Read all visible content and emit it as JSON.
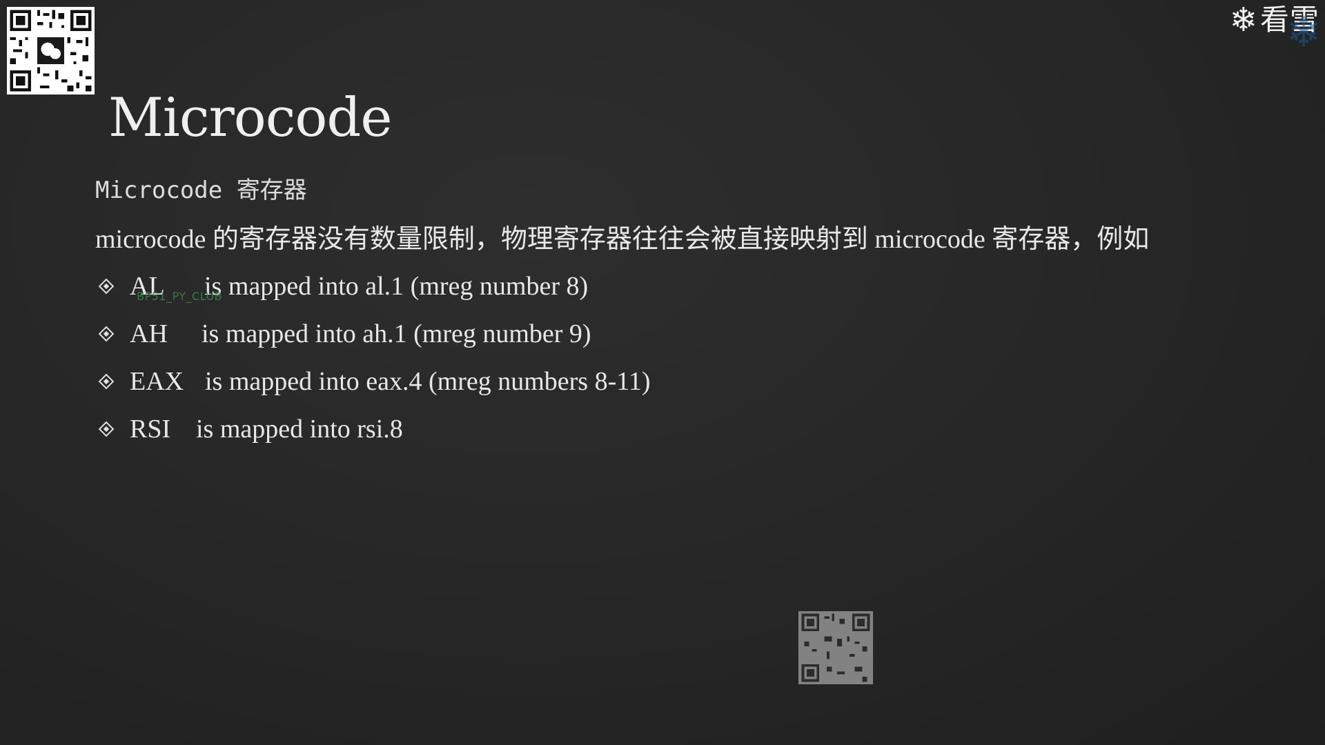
{
  "slide": {
    "title": "Microcode",
    "subtitle": "Microcode 寄存器",
    "intro": "microcode 的寄存器没有数量限制，物理寄存器往往会被直接映射到 microcode 寄存器，例如",
    "bullets": [
      {
        "register": "AL",
        "description": "is mapped into al.1 (mreg number 8)"
      },
      {
        "register": "AH",
        "description": "is mapped into ah.1 (mreg number 9)"
      },
      {
        "register": "EAX",
        "description": "is mapped into eax.4 (mreg numbers 8-11)"
      },
      {
        "register": "RSI",
        "description": "is mapped into rsi.8"
      }
    ]
  },
  "overlays": {
    "watermark": "BP51_PY_CLUB",
    "brand_text": "看雪",
    "brand_icon": "snowflake-icon",
    "qr_icon": "qr-code-icon"
  },
  "colors": {
    "background": "#262626",
    "text": "#e8e8e8",
    "watermark": "#3d8c4a",
    "brand_accent": "#1f5a9a"
  }
}
